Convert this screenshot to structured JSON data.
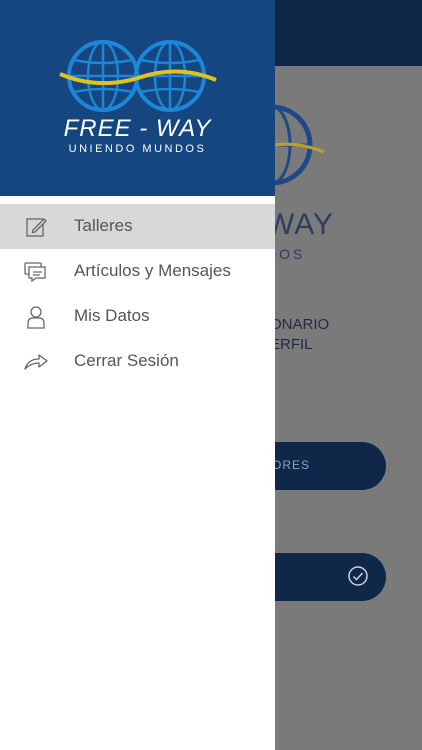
{
  "background": {
    "brand_partial": "WAY",
    "brand_sub_partial": "DOS",
    "text_line1": "ONARIO",
    "text_line2": "ERFIL",
    "button1_label": "ORES",
    "check_icon": "check-circle-icon"
  },
  "drawer": {
    "brand_title": "FREE - WAY",
    "brand_subtitle": "UNIENDO MUNDOS",
    "menu": [
      {
        "label": "Talleres",
        "icon": "edit-icon",
        "active": true
      },
      {
        "label": "Artículos y Mensajes",
        "icon": "messages-icon",
        "active": false
      },
      {
        "label": "Mis Datos",
        "icon": "user-icon",
        "active": false
      },
      {
        "label": "Cerrar Sesión",
        "icon": "share-logout-icon",
        "active": false
      }
    ]
  },
  "colors": {
    "drawer_header": "#16467f",
    "app_header": "#0f2748",
    "active_item": "#d8d8d8",
    "logo_accent": "#e2c21c"
  }
}
